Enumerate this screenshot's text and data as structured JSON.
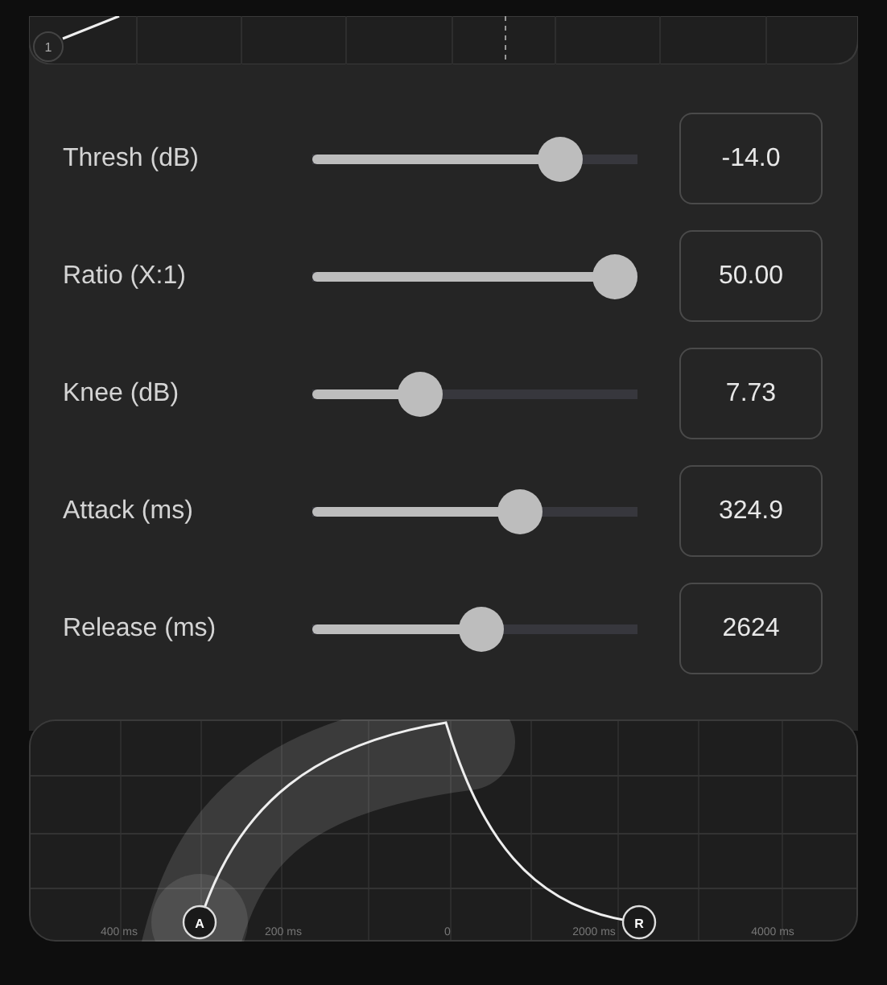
{
  "top_graph": {
    "handle": "1"
  },
  "params": [
    {
      "label": "Thresh (dB)",
      "level": 0.76,
      "value": "-14.0"
    },
    {
      "label": "Ratio (X:1)",
      "level": 0.97,
      "value": "50.00"
    },
    {
      "label": "Knee (dB)",
      "level": 0.33,
      "value": "7.73"
    },
    {
      "label": "Attack (ms)",
      "level": 0.64,
      "value": "324.9"
    },
    {
      "label": "Release (ms)",
      "level": 0.52,
      "value": "2624"
    }
  ],
  "envelope_graph": {
    "x_labels": [
      "400 ms",
      "200 ms",
      "0",
      "2000 ms",
      "4000 ms"
    ],
    "handles": [
      "A",
      "R"
    ]
  }
}
